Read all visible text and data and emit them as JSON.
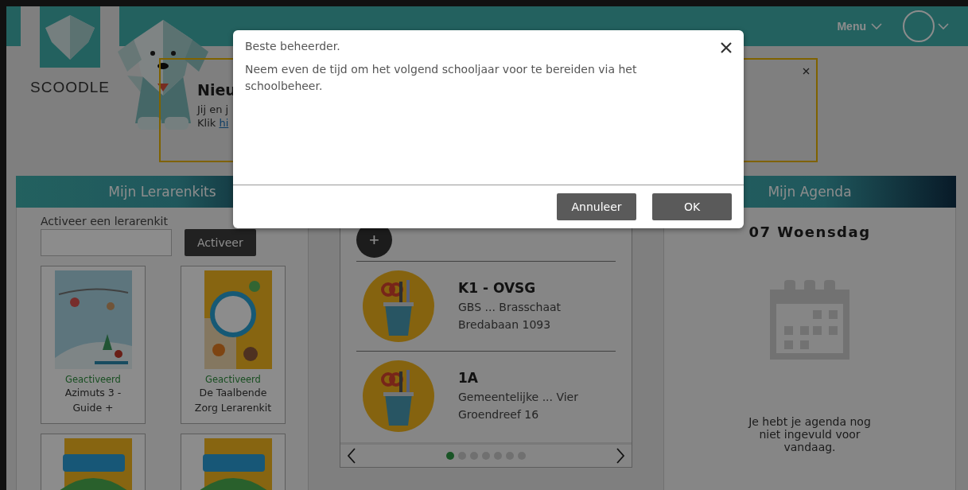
{
  "header": {
    "logo": "SCOODLE",
    "menu": "Menu"
  },
  "banner": {
    "title": "Nieu",
    "line_1": "Jij en j",
    "line_2": "Klik",
    "link": "hi"
  },
  "kits_panel": {
    "title": "Mijn Lerarenkits",
    "field_label": "Activeer een lerarenkit",
    "button": "Activeer",
    "kits": [
      {
        "kind": "picture",
        "status": "Geactiveerd",
        "title": "Azimuts 3 - Guide +"
      },
      {
        "kind": "picture",
        "status": "Geactiveerd",
        "title": "De Taalbende Zorg Lerarenkit"
      },
      {
        "kind": "picture"
      },
      {
        "kind": "picture"
      }
    ]
  },
  "classes_panel": {
    "add_button": "+",
    "classes": [
      {
        "name": "K1 - OVSG",
        "school": "GBS ... Brasschaat",
        "address": "Bredabaan 1093"
      },
      {
        "name": "1A",
        "school": "Gemeentelijke ... Vier",
        "address": "Groendreef 16"
      }
    ],
    "pager": [
      {
        "selected": true
      },
      {
        "selected": false
      },
      {
        "selected": false
      },
      {
        "selected": false
      },
      {
        "selected": false
      },
      {
        "selected": false
      },
      {
        "selected": false
      }
    ]
  },
  "agenda_panel": {
    "title": "Mijn Agenda",
    "date": "07 Woensdag",
    "empty_text": "Je hebt je agenda nog niet ingevuld voor vandaag."
  },
  "modal": {
    "title": "Beste beheerder.",
    "message": "Neem even de tijd om het volgend schooljaar voor te bereiden via het schoolbeheer.",
    "buttons": [
      "Annuleer",
      "OK"
    ]
  }
}
